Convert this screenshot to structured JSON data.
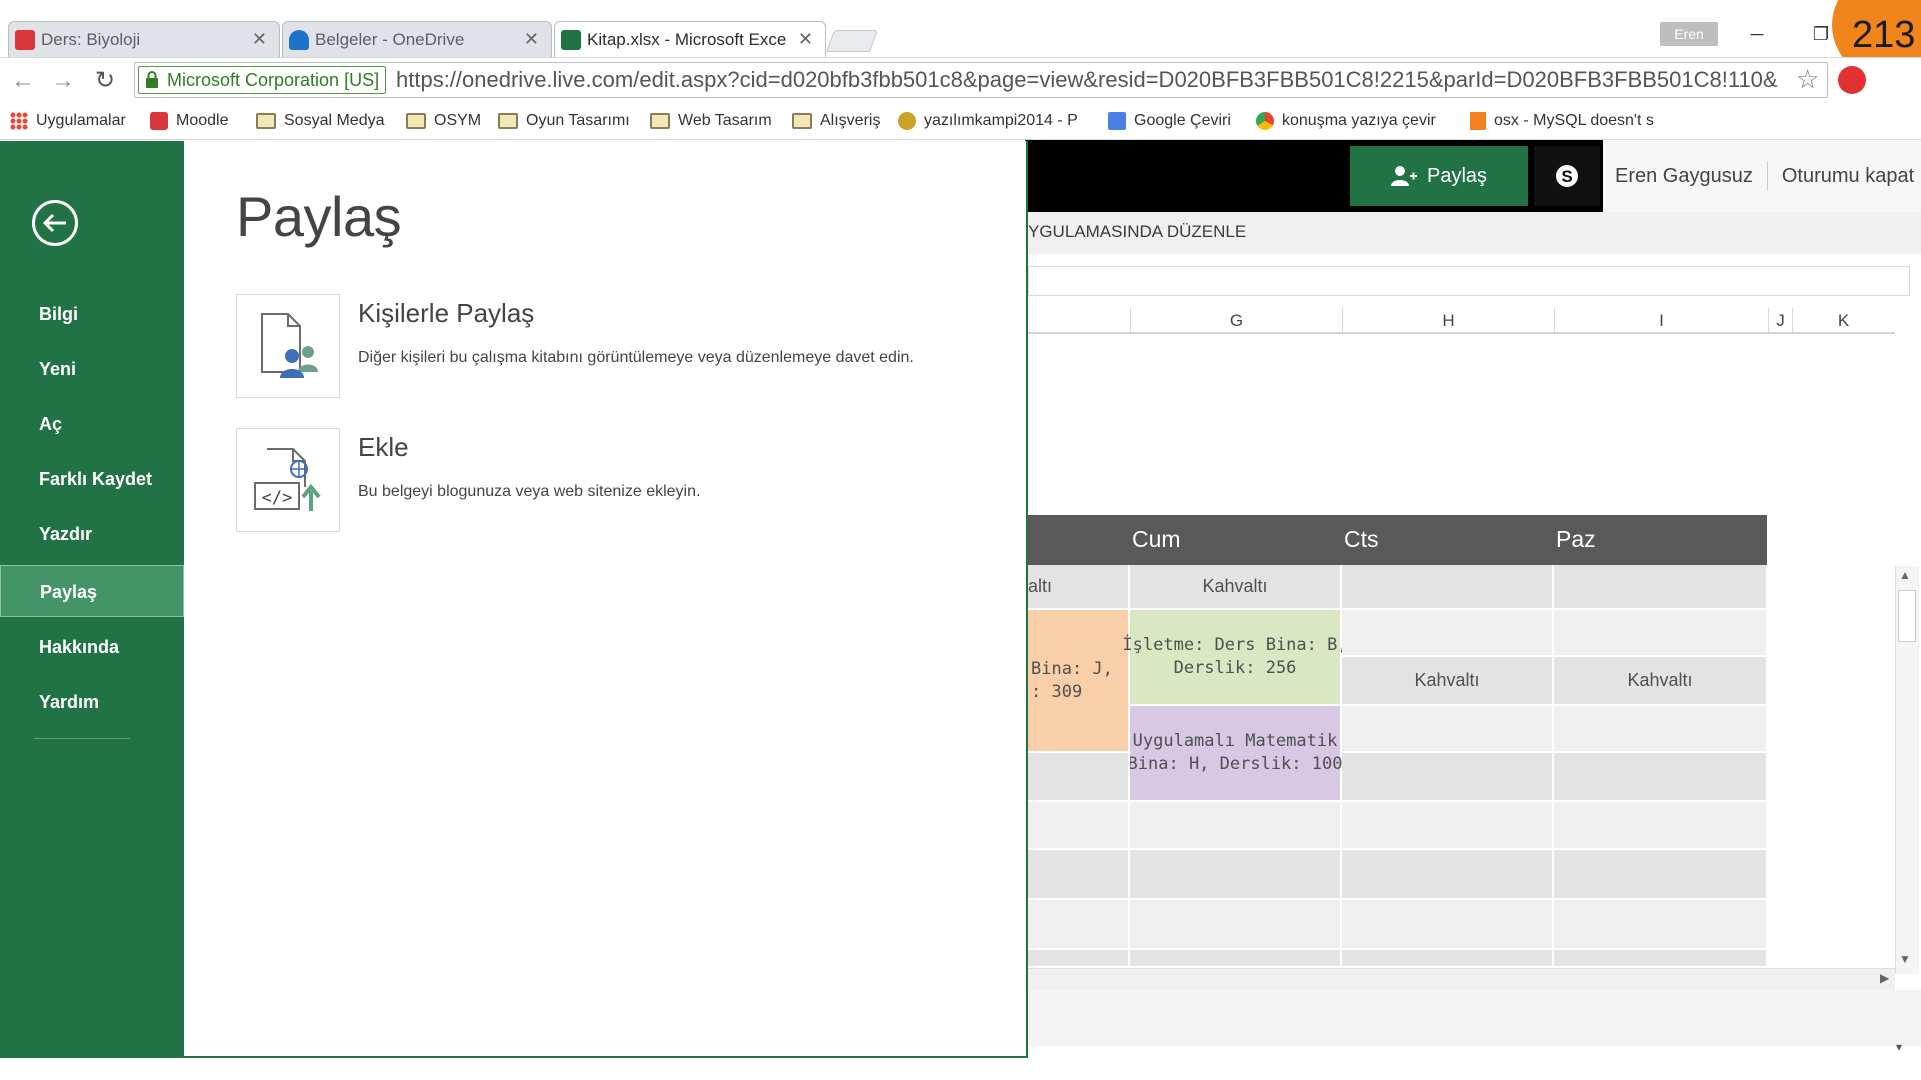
{
  "browser": {
    "tabs": [
      {
        "title": "Ders: Biyoloji",
        "favicon_color": "#d9363e"
      },
      {
        "title": "Belgeler - OneDrive",
        "favicon_color": "#1e73c8"
      },
      {
        "title": "Kitap.xlsx - Microsoft Exce",
        "favicon_color": "#217346"
      }
    ],
    "profile_name": "Eren",
    "badge_count": "213",
    "ev_label": "Microsoft Corporation [US]",
    "url": "https://onedrive.live.com/edit.aspx?cid=d020bfb3fbb501c8&page=view&resid=D020BFB3FBB501C8!2215&parId=D020BFB3FBB501C8!110&",
    "bookmarks": [
      "Uygulamalar",
      "Moodle",
      "Sosyal Medya",
      "OSYM",
      "Oyun Tasarımı",
      "Web Tasarım",
      "Alışveriş",
      "yazılımkampi2014 - P",
      "Google Çeviri",
      "konuşma yazıya çevir",
      "osx - MySQL doesn't s"
    ]
  },
  "excel": {
    "share_label": "Paylaş",
    "user_name": "Eren Gaygusuz",
    "sign_out_label": "Oturumu kapat",
    "edit_in_app_label": "YGULAMASINDA DÜZENLE",
    "columns": [
      "G",
      "H",
      "I",
      "J",
      "K"
    ],
    "schedule": {
      "days": [
        "Cum",
        "Cts",
        "Paz"
      ],
      "cells": {
        "partial_top": "altı",
        "cum_row1": "Kahvaltı",
        "partial_mid": "Bina: J,\n: 309",
        "cum_row2": "İşletme: Ders Bina: B,\nDerslik: 256",
        "cts_row2": "Kahvaltı",
        "paz_row2": "Kahvaltı",
        "cum_row3": "Uygulamalı Matematik\nBina: H, Derslik: 100"
      }
    }
  },
  "backstage": {
    "nav_items": [
      "Bilgi",
      "Yeni",
      "Aç",
      "Farklı Kaydet",
      "Yazdır",
      "Paylaş",
      "Hakkında",
      "Yardım"
    ],
    "active_item": "Paylaş",
    "page_title": "Paylaş",
    "options": [
      {
        "title": "Kişilerle Paylaş",
        "description": "Diğer kişileri bu çalışma kitabını görüntülemeye veya düzenlemeye davet edin."
      },
      {
        "title": "Ekle",
        "description": "Bu belgeyi blogunuza veya web sitenize ekleyin."
      }
    ]
  },
  "colors": {
    "excel_green": "#217346",
    "nav_active": "#439467",
    "peach_cell": "#f9cfa9",
    "green_cell": "#d9e7c3",
    "purple_cell": "#d8c8e4",
    "gray_cell": "#e3e3e3",
    "light_cell": "#efefef"
  }
}
